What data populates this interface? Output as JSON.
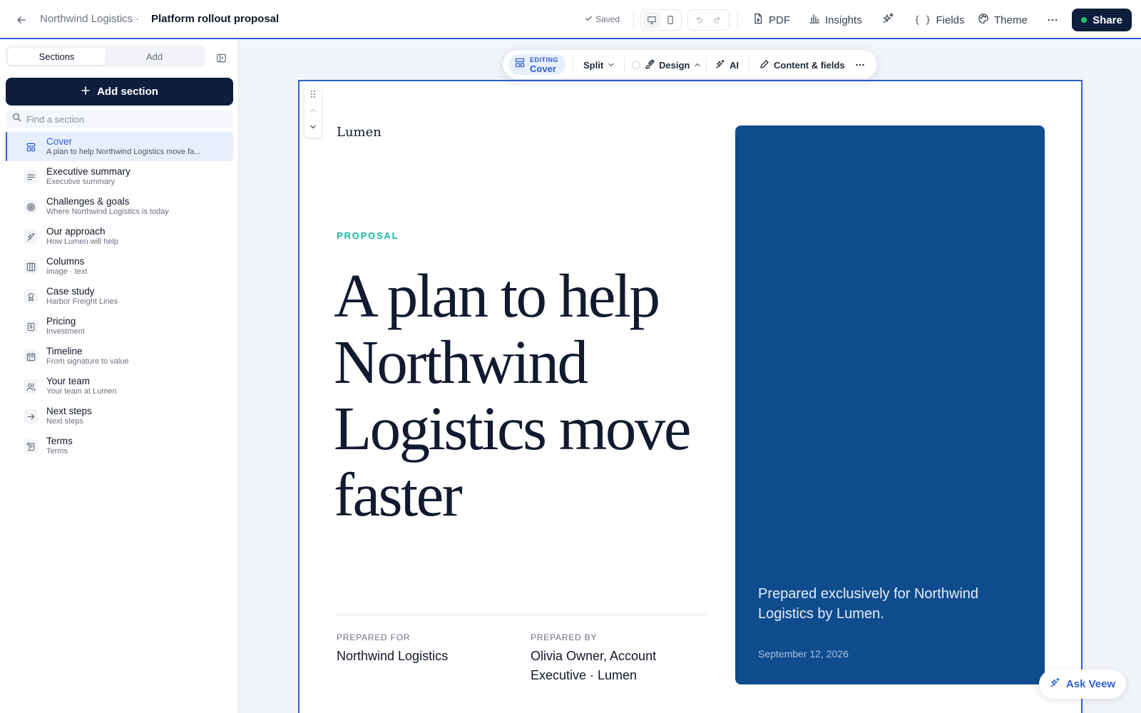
{
  "header": {
    "breadcrumb": "Northwind Logistics ·",
    "doc_title": "Platform rollout proposal",
    "saved_label": "Saved",
    "pdf_label": "PDF",
    "insights_label": "Insights",
    "fields_label": "Fields",
    "theme_label": "Theme",
    "share_label": "Share"
  },
  "sidebar": {
    "tabs": [
      {
        "label": "Sections",
        "active": true
      },
      {
        "label": "Add",
        "active": false
      }
    ],
    "add_section_label": "Add section",
    "search_placeholder": "Find a section",
    "sections": [
      {
        "name": "Cover",
        "sub": "A plan to help Northwind Logistics move fa...",
        "icon": "layout-icon",
        "active": true
      },
      {
        "name": "Executive summary",
        "sub": "Executive summary",
        "icon": "text-lines-icon"
      },
      {
        "name": "Challenges & goals",
        "sub": "Where Northwind Logistics is today",
        "icon": "target-icon"
      },
      {
        "name": "Our approach",
        "sub": "How Lumen will help",
        "icon": "sparkles-icon"
      },
      {
        "name": "Columns",
        "sub": "image · text",
        "icon": "columns-icon"
      },
      {
        "name": "Case study",
        "sub": "Harbor Freight Lines",
        "icon": "award-icon"
      },
      {
        "name": "Pricing",
        "sub": "Investment",
        "icon": "receipt-icon"
      },
      {
        "name": "Timeline",
        "sub": "From signature to value",
        "icon": "calendar-icon"
      },
      {
        "name": "Your team",
        "sub": "Your team at Lumen",
        "icon": "users-icon"
      },
      {
        "name": "Next steps",
        "sub": "Next steps",
        "icon": "arrow-right-icon"
      },
      {
        "name": "Terms",
        "sub": "Terms",
        "icon": "scroll-icon"
      }
    ]
  },
  "toolbar": {
    "editing_label": "EDITING",
    "editing_section": "Cover",
    "layout_label": "Split",
    "design_label": "Design",
    "ai_label": "AI",
    "content_label": "Content & fields"
  },
  "cover": {
    "logo": "Lumen",
    "eyebrow": "PROPOSAL",
    "headline": "A plan to help Northwind Logistics move faster",
    "prepared_for_label": "PREPARED FOR",
    "prepared_for_value": "Northwind Logistics",
    "prepared_by_label": "PREPARED BY",
    "prepared_by_value": "Olivia Owner, Account Executive · Lumen",
    "panel_text": "Prepared exclusively for Northwind Logistics by Lumen.",
    "panel_date": "September 12, 2026"
  },
  "assistant": {
    "label": "Ask Veew"
  },
  "colors": {
    "brand_navy": "#0f1e3d",
    "accent_blue": "#2f5fd0",
    "panel_blue": "#0f4c8e",
    "eyebrow_teal": "#1ab6a2"
  }
}
